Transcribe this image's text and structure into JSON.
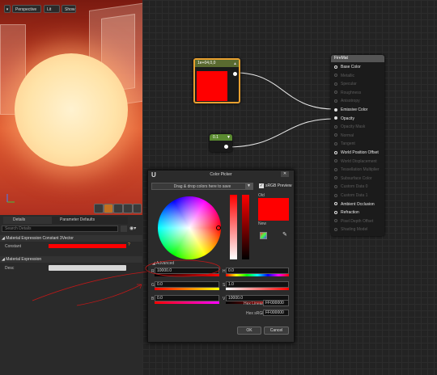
{
  "viewport": {
    "perspective_label": "Perspective",
    "lit_label": "Lit",
    "show_label": "Show"
  },
  "details": {
    "tab_details": "Details",
    "tab_parameter_defaults": "Parameter Defaults",
    "search_placeholder": "Search Details",
    "section_constant": "Material Expression Constant 3Vector",
    "constant_label": "Constant",
    "section_expression": "Material Expression",
    "desc_label": "Desc"
  },
  "graph": {
    "constant_node_title": "1e+04,0,0",
    "scalar_node_value": "0.1",
    "material_node_title": "FireMat",
    "material_inputs": [
      {
        "label": "Base Color",
        "active": true
      },
      {
        "label": "Metallic",
        "active": false
      },
      {
        "label": "Specular",
        "active": false
      },
      {
        "label": "Roughness",
        "active": false
      },
      {
        "label": "Anisotropy",
        "active": false
      },
      {
        "label": "Emissive Color",
        "active": true
      },
      {
        "label": "Opacity",
        "active": true
      },
      {
        "label": "Opacity Mask",
        "active": false
      },
      {
        "label": "Normal",
        "active": false
      },
      {
        "label": "Tangent",
        "active": false
      },
      {
        "label": "World Position Offset",
        "active": true
      },
      {
        "label": "World Displacement",
        "active": false
      },
      {
        "label": "Tessellation Multiplier",
        "active": false
      },
      {
        "label": "Subsurface Color",
        "active": false
      },
      {
        "label": "Custom Data 0",
        "active": false
      },
      {
        "label": "Custom Data 1",
        "active": false
      },
      {
        "label": "Ambient Occlusion",
        "active": true
      },
      {
        "label": "Refraction",
        "active": true
      },
      {
        "label": "Pixel Depth Offset",
        "active": false
      },
      {
        "label": "Shading Model",
        "active": false
      }
    ]
  },
  "picker": {
    "title": "Color Picker",
    "logo": "U",
    "drop_label": "Drag & drop colors here to save",
    "srgb_label": "sRGB Preview",
    "old_label": "Old",
    "new_label": "New",
    "advanced_label": "Advanced",
    "r_label": "R",
    "g_label": "G",
    "b_label": "B",
    "h_label": "H",
    "s_label": "S",
    "v_label": "V",
    "r_value": "10000.0",
    "g_value": "0.0",
    "b_value": "0.0",
    "h_value": "0.0",
    "s_value": "1.0",
    "v_value": "10000.0",
    "hex_linear_label": "Hex Linear",
    "hex_linear_value": "FF000000",
    "hex_srgb_label": "Hex sRGB",
    "hex_srgb_value": "FF000000",
    "ok_label": "OK",
    "cancel_label": "Cancel"
  },
  "colors": {
    "selected_red": "#ff0000",
    "node_border_selected": "#e8a030",
    "annotation_red": "#c01818"
  }
}
